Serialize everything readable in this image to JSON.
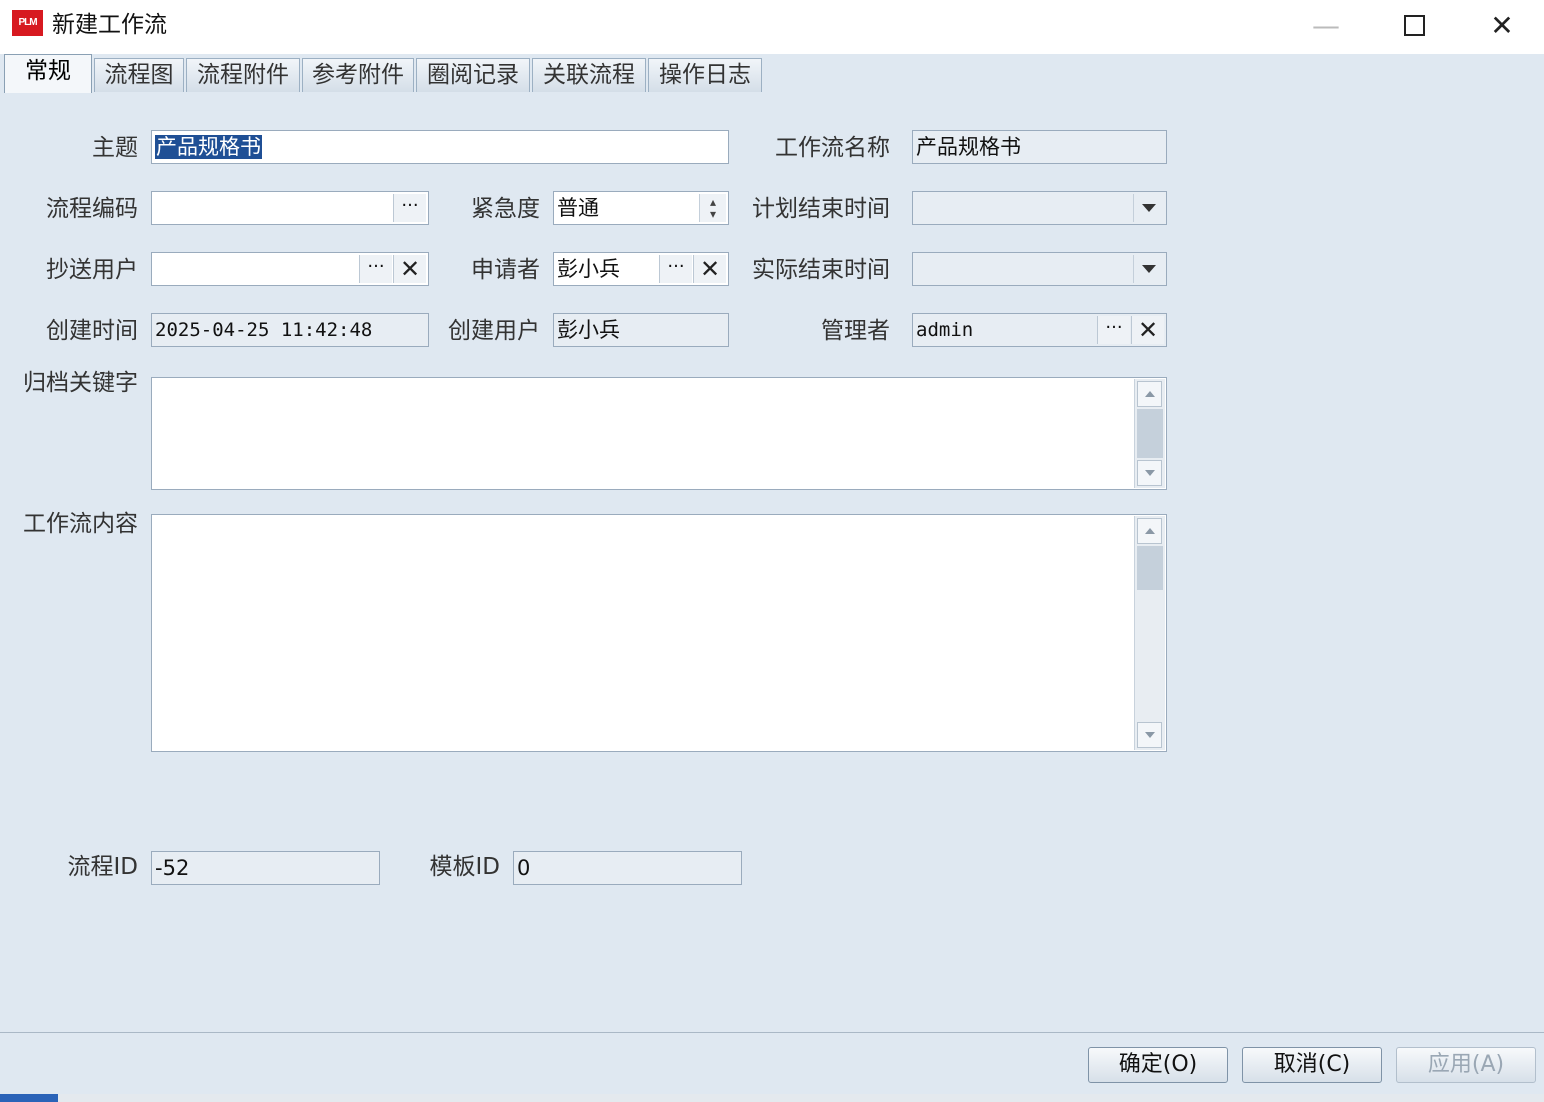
{
  "window": {
    "logo": "PLM",
    "title": "新建工作流",
    "minimize_icon": "—",
    "close_icon": "✕"
  },
  "tabs": [
    {
      "label": "常规",
      "active": true
    },
    {
      "label": "流程图"
    },
    {
      "label": "流程附件"
    },
    {
      "label": "参考附件"
    },
    {
      "label": "圈阅记录"
    },
    {
      "label": "关联流程"
    },
    {
      "label": "操作日志"
    }
  ],
  "form": {
    "subject_label": "主题",
    "subject_value": "产品规格书",
    "workflow_name_label": "工作流名称",
    "workflow_name_value": "产品规格书",
    "process_code_label": "流程编码",
    "process_code_value": "",
    "urgency_label": "紧急度",
    "urgency_value": "普通",
    "planned_end_label": "计划结束时间",
    "planned_end_value": "",
    "cc_users_label": "抄送用户",
    "cc_users_value": "",
    "applicant_label": "申请者",
    "applicant_value": "彭小兵",
    "actual_end_label": "实际结束时间",
    "actual_end_value": "",
    "created_time_label": "创建时间",
    "created_time_value": "2025-04-25 11:42:48",
    "created_user_label": "创建用户",
    "created_user_value": "彭小兵",
    "manager_label": "管理者",
    "manager_value": "admin",
    "archive_keywords_label": "归档关键字",
    "workflow_content_label": "工作流内容",
    "process_id_label": "流程ID",
    "process_id_value": "-52",
    "template_id_label": "模板ID",
    "template_id_value": "0",
    "dots_label": "···",
    "clear_label": "✕",
    "spinner_up": "▴",
    "spinner_down": "▾"
  },
  "footer": {
    "ok_label": "确定(O)",
    "cancel_label": "取消(C)",
    "apply_label": "应用(A)"
  }
}
